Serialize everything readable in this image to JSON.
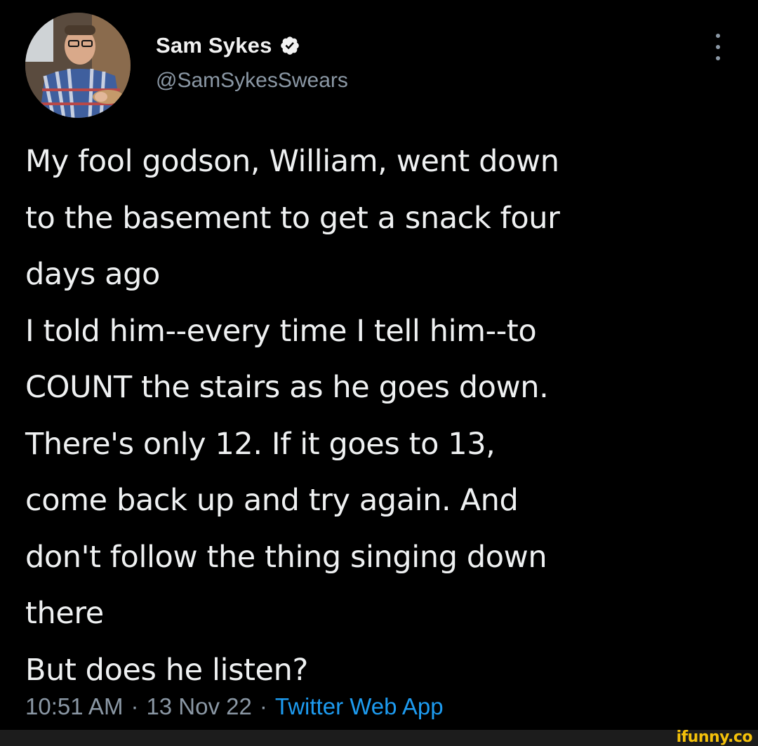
{
  "author": {
    "display_name": "Sam Sykes",
    "handle": "@SamSykesSwears",
    "verified_icon": "verified-badge-icon",
    "badge_color": "#1d9bf0"
  },
  "tweet": {
    "lines": [
      "My fool godson, William, went down",
      "to the basement to get a snack four",
      "days ago",
      "I told him--every time I tell him--to",
      "COUNT the stairs as he goes down.",
      "There's only 12. If it goes to 13,",
      "come back up and try again. And",
      "don't follow the thing singing down",
      "there",
      "But does he listen?"
    ]
  },
  "meta": {
    "time": "10:51 AM",
    "separator": "·",
    "date": "13 Nov 22",
    "source": "Twitter Web App",
    "source_color": "#1d9bf0"
  },
  "more_icon": "more-options-icon",
  "watermark": "ifunny.co",
  "colors": {
    "background": "#000000",
    "text": "#e7e9ea",
    "secondary": "#8b98a5",
    "watermark": "#f4c10a"
  }
}
